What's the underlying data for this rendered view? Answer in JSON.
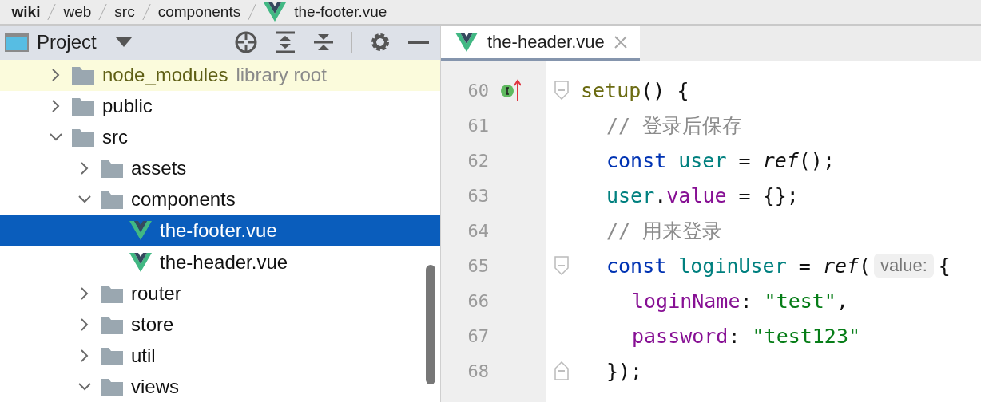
{
  "breadcrumbs": [
    {
      "label": "_wiki",
      "kind": "folder"
    },
    {
      "label": "web",
      "kind": "folder"
    },
    {
      "label": "src",
      "kind": "folder"
    },
    {
      "label": "components",
      "kind": "folder"
    },
    {
      "label": "the-footer.vue",
      "kind": "vue"
    }
  ],
  "project_panel": {
    "title": "Project"
  },
  "tree": [
    {
      "label": "node_modules",
      "suffix": "library root",
      "kind": "folder",
      "expanded": false,
      "selected": false,
      "excluded": true
    },
    {
      "label": "public",
      "kind": "folder",
      "expanded": false,
      "selected": false
    },
    {
      "label": "src",
      "kind": "folder",
      "expanded": true,
      "selected": false,
      "children": [
        {
          "label": "assets",
          "kind": "folder",
          "expanded": false,
          "selected": false
        },
        {
          "label": "components",
          "kind": "folder",
          "expanded": true,
          "selected": false,
          "children": [
            {
              "label": "the-footer.vue",
              "kind": "vue",
              "selected": true
            },
            {
              "label": "the-header.vue",
              "kind": "vue",
              "selected": false
            }
          ]
        },
        {
          "label": "router",
          "kind": "folder",
          "expanded": false,
          "selected": false
        },
        {
          "label": "store",
          "kind": "folder",
          "expanded": false,
          "selected": false
        },
        {
          "label": "util",
          "kind": "folder",
          "expanded": false,
          "selected": false
        },
        {
          "label": "views",
          "kind": "folder",
          "expanded": true,
          "selected": false
        }
      ]
    }
  ],
  "editor_tabs": [
    {
      "label": "the-header.vue",
      "selected": true
    }
  ],
  "code_lines": [
    {
      "number": "60",
      "implements": true,
      "expanded": true,
      "tokens": [
        {
          "kind": "fn",
          "text": "setup"
        },
        {
          "kind": "plain",
          "text": "() {"
        }
      ],
      "children": [
        {
          "number": "61",
          "tokens": [
            {
              "kind": "comment",
              "text": "// 登录后保存"
            }
          ]
        },
        {
          "number": "62",
          "tokens": [
            {
              "kind": "keyword",
              "text": "const"
            },
            {
              "kind": "var",
              "text": "user"
            },
            {
              "kind": "plain",
              "text": " = "
            },
            {
              "kind": "call",
              "text": "ref"
            },
            {
              "kind": "plain",
              "text": "();"
            }
          ]
        },
        {
          "number": "63",
          "tokens": [
            {
              "kind": "var",
              "text": "user"
            },
            {
              "kind": "plain",
              "text": "."
            },
            {
              "kind": "prop",
              "text": "value"
            },
            {
              "kind": "plain",
              "text": " = {};"
            }
          ]
        },
        {
          "number": "64",
          "tokens": [
            {
              "kind": "comment",
              "text": "// 用来登录"
            }
          ]
        },
        {
          "number": "65",
          "expanded": true,
          "tokens": [
            {
              "kind": "keyword",
              "text": "const"
            },
            {
              "kind": "var",
              "text": "loginUser"
            },
            {
              "kind": "plain",
              "text": " = "
            },
            {
              "kind": "call",
              "text": "ref"
            },
            {
              "kind": "plain",
              "text": "("
            },
            {
              "kind": "hint",
              "text": "value:"
            },
            {
              "kind": "plain",
              "text": "{"
            }
          ],
          "children": [
            {
              "number": "66",
              "tokens": [
                {
                  "kind": "prop",
                  "text": "loginName"
                },
                {
                  "kind": "plain",
                  "text": ": "
                },
                {
                  "kind": "str",
                  "text": "\"test\""
                },
                {
                  "kind": "plain",
                  "text": ","
                }
              ]
            },
            {
              "number": "67",
              "tokens": [
                {
                  "kind": "prop",
                  "text": "password"
                },
                {
                  "kind": "plain",
                  "text": ": "
                },
                {
                  "kind": "str",
                  "text": "\"test123\""
                }
              ]
            }
          ]
        },
        {
          "number": "68",
          "fold_end": true,
          "tokens": [
            {
              "kind": "plain",
              "text": "});"
            }
          ]
        }
      ]
    }
  ]
}
